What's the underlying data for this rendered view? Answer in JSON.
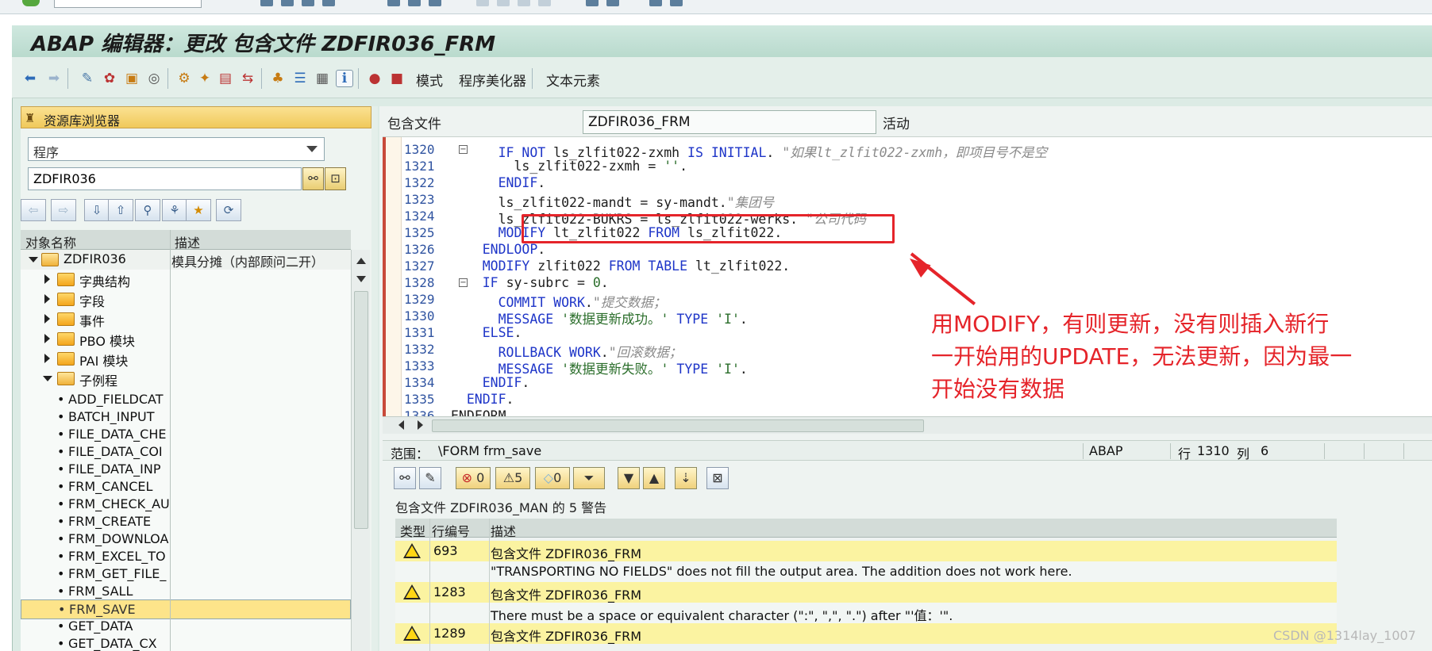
{
  "window": {
    "title": "ABAP 编辑器：更改 包含文件 ZDFIR036_FRM"
  },
  "app_toolbar": {
    "mode_label": "模式",
    "pretty_printer_label": "程序美化器",
    "text_elements_label": "文本元素"
  },
  "repo_browser": {
    "title": "资源库浏览器",
    "object_type": "程序",
    "object_name": "ZDFIR036",
    "columns": [
      "对象名称",
      "描述"
    ],
    "tree": [
      {
        "label": "ZDFIR036",
        "desc": "模具分摊（内部顾问二开）"
      },
      {
        "label": "字典结构"
      },
      {
        "label": "字段"
      },
      {
        "label": "事件"
      },
      {
        "label": "PBO 模块"
      },
      {
        "label": "PAI 模块"
      },
      {
        "label": "子例程"
      },
      {
        "label": "ADD_FIELDCAT"
      },
      {
        "label": "BATCH_INPUT"
      },
      {
        "label": "FILE_DATA_CHE"
      },
      {
        "label": "FILE_DATA_COI"
      },
      {
        "label": "FILE_DATA_INP"
      },
      {
        "label": "FRM_CANCEL"
      },
      {
        "label": "FRM_CHECK_AU"
      },
      {
        "label": "FRM_CREATE"
      },
      {
        "label": "FRM_DOWNLOA"
      },
      {
        "label": "FRM_EXCEL_TO"
      },
      {
        "label": "FRM_GET_FILE_"
      },
      {
        "label": "FRM_SALL"
      },
      {
        "label": "FRM_SAVE"
      },
      {
        "label": "GET_DATA"
      },
      {
        "label": "GET_DATA_CX"
      }
    ]
  },
  "editor": {
    "include_label": "包含文件",
    "include_name": "ZDFIR036_FRM",
    "state": "活动",
    "line_numbers": [
      "1320",
      "1321",
      "1322",
      "1323",
      "1324",
      "1325",
      "1326",
      "1327",
      "1328",
      "1329",
      "1330",
      "1331",
      "1332",
      "1333",
      "1334",
      "1335",
      "1336"
    ],
    "lines": [
      {
        "i": "      ",
        "p": [
          {
            "t": "IF NOT ",
            "c": "kw"
          },
          {
            "t": "ls_zlfit022-zxmh ",
            "c": ""
          },
          {
            "t": "IS INITIAL",
            "c": "kw"
          },
          {
            "t": ". ",
            "c": ""
          },
          {
            "t": "\"如果lt_zlfit022-zxmh，即项目号不是空",
            "c": "cm"
          }
        ]
      },
      {
        "i": "        ",
        "p": [
          {
            "t": "ls_zlfit022-zxmh = ",
            "c": ""
          },
          {
            "t": "''",
            "c": "str"
          },
          {
            "t": ".",
            "c": ""
          }
        ]
      },
      {
        "i": "      ",
        "p": [
          {
            "t": "ENDIF",
            "c": "kw"
          },
          {
            "t": ".",
            "c": ""
          }
        ]
      },
      {
        "i": "      ",
        "p": [
          {
            "t": "ls_zlfit022-mandt = sy-mandt.",
            "c": ""
          },
          {
            "t": "\"集团号",
            "c": "cm"
          }
        ]
      },
      {
        "i": "      ",
        "p": [
          {
            "t": "ls_zlfit022-BUKRS = ls_zlfit022-werks. ",
            "c": ""
          },
          {
            "t": "\"公司代码",
            "c": "cm"
          }
        ]
      },
      {
        "i": "      ",
        "p": [
          {
            "t": "MODIFY ",
            "c": "kw"
          },
          {
            "t": "lt_zlfit022 ",
            "c": ""
          },
          {
            "t": "FROM ",
            "c": "kw"
          },
          {
            "t": "ls_zlfit022.",
            "c": ""
          }
        ]
      },
      {
        "i": "    ",
        "p": [
          {
            "t": "ENDLOOP",
            "c": "kw"
          },
          {
            "t": ".",
            "c": ""
          }
        ]
      },
      {
        "i": "    ",
        "p": [
          {
            "t": "MODIFY ",
            "c": "kw"
          },
          {
            "t": "zlfit022 ",
            "c": ""
          },
          {
            "t": "FROM TABLE ",
            "c": "kw"
          },
          {
            "t": "lt_zlfit022.",
            "c": ""
          }
        ]
      },
      {
        "i": "    ",
        "p": [
          {
            "t": "IF ",
            "c": "kw"
          },
          {
            "t": "sy-subrc = ",
            "c": ""
          },
          {
            "t": "0",
            "c": "num"
          },
          {
            "t": ".",
            "c": ""
          }
        ]
      },
      {
        "i": "      ",
        "p": [
          {
            "t": "COMMIT WORK",
            "c": "kw"
          },
          {
            "t": ".",
            "c": ""
          },
          {
            "t": "\"提交数据；",
            "c": "cm"
          }
        ]
      },
      {
        "i": "      ",
        "p": [
          {
            "t": "MESSAGE ",
            "c": "kw"
          },
          {
            "t": "'数据更新成功。'",
            "c": "str"
          },
          {
            "t": " ",
            "c": ""
          },
          {
            "t": "TYPE ",
            "c": "kw"
          },
          {
            "t": "'I'",
            "c": "str"
          },
          {
            "t": ".",
            "c": ""
          }
        ]
      },
      {
        "i": "    ",
        "p": [
          {
            "t": "ELSE",
            "c": "kw"
          },
          {
            "t": ".",
            "c": ""
          }
        ]
      },
      {
        "i": "      ",
        "p": [
          {
            "t": "ROLLBACK WORK",
            "c": "kw"
          },
          {
            "t": ".",
            "c": ""
          },
          {
            "t": "\"回滚数据；",
            "c": "cm"
          }
        ]
      },
      {
        "i": "      ",
        "p": [
          {
            "t": "MESSAGE ",
            "c": "kw"
          },
          {
            "t": "'数据更新失败。'",
            "c": "str"
          },
          {
            "t": " ",
            "c": ""
          },
          {
            "t": "TYPE ",
            "c": "kw"
          },
          {
            "t": "'I'",
            "c": "str"
          },
          {
            "t": ".",
            "c": ""
          }
        ]
      },
      {
        "i": "    ",
        "p": [
          {
            "t": "ENDIF",
            "c": "kw"
          },
          {
            "t": ".",
            "c": ""
          }
        ]
      },
      {
        "i": "  ",
        "p": [
          {
            "t": "ENDIF",
            "c": "kw"
          },
          {
            "t": ".",
            "c": ""
          }
        ]
      },
      {
        "i": "",
        "p": [
          {
            "t": "ENDFORM",
            "c": ""
          }
        ]
      }
    ]
  },
  "status": {
    "scope_label": "范围：",
    "scope_value": "\\FORM frm_save",
    "language": "ABAP",
    "row_label": "行",
    "row": "1310",
    "col_label": "列",
    "col": "6"
  },
  "annotation": {
    "line1": "用MODIFY，有则更新，没有则插入新行",
    "line2": "一开始用的UPDATE，无法更新，因为最一",
    "line3": "开始没有数据"
  },
  "messages": {
    "errors": "0",
    "warnings": "5",
    "infos": "0",
    "summary": "包含文件 ZDFIR036_MAN 的 5 警告",
    "columns": [
      "类型",
      "行编号",
      "描述"
    ],
    "rows": [
      {
        "line": "693",
        "desc": "包含文件 ZDFIR036_FRM",
        "detail": "\"TRANSPORTING NO FIELDS\" does not fill the output area. The addition does not work here."
      },
      {
        "line": "1283",
        "desc": "包含文件 ZDFIR036_FRM",
        "detail": "There must be a space or equivalent character (\":\", \",\", \".\") after \"'值：'\"."
      },
      {
        "line": "1289",
        "desc": "包含文件 ZDFIR036_FRM",
        "detail": ""
      }
    ]
  },
  "watermark": "CSDN @1314lay_1007"
}
